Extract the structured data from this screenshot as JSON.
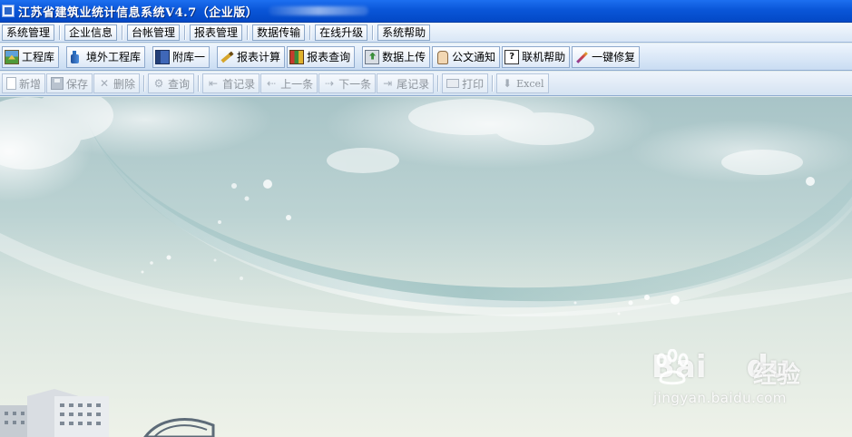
{
  "window": {
    "title": "江苏省建筑业统计信息系统V4.7（企业版）"
  },
  "menu": {
    "items": [
      "系统管理",
      "企业信息",
      "台帐管理",
      "报表管理",
      "数据传输",
      "在线升级",
      "系统帮助"
    ]
  },
  "modules": {
    "items": [
      {
        "label": "工程库",
        "icon": "landscape-icon"
      },
      {
        "label": "境外工程库",
        "icon": "bottle-icon"
      },
      {
        "label": "附库一",
        "icon": "book-icon"
      },
      {
        "label": "报表计算",
        "icon": "pencil-icon"
      },
      {
        "label": "报表查询",
        "icon": "books-icon"
      },
      {
        "label": "数据上传",
        "icon": "upload-icon"
      },
      {
        "label": "公文通知",
        "icon": "hand-icon"
      },
      {
        "label": "联机帮助",
        "icon": "help-icon",
        "glyph": "?"
      },
      {
        "label": "一键修复",
        "icon": "wrench-icon"
      }
    ]
  },
  "actions": {
    "items": [
      {
        "label": "新增",
        "icon": "new-doc-icon"
      },
      {
        "label": "保存",
        "icon": "save-disk-icon"
      },
      {
        "label": "删除",
        "icon": "delete-x-icon"
      },
      {
        "label": "查询",
        "icon": "query-icon"
      },
      {
        "label": "首记录",
        "icon": "first-record-icon"
      },
      {
        "label": "上一条",
        "icon": "previous-arrow-icon"
      },
      {
        "label": "下一条",
        "icon": "next-arrow-icon"
      },
      {
        "label": "尾记录",
        "icon": "last-record-icon"
      },
      {
        "label": "打印",
        "icon": "printer-icon"
      },
      {
        "label": "Excel",
        "icon": "excel-export-icon"
      }
    ]
  },
  "watermark": {
    "brand": "Bai",
    "brand_du": "du",
    "cn": "经验",
    "url": "jingyan.baidu.com"
  }
}
